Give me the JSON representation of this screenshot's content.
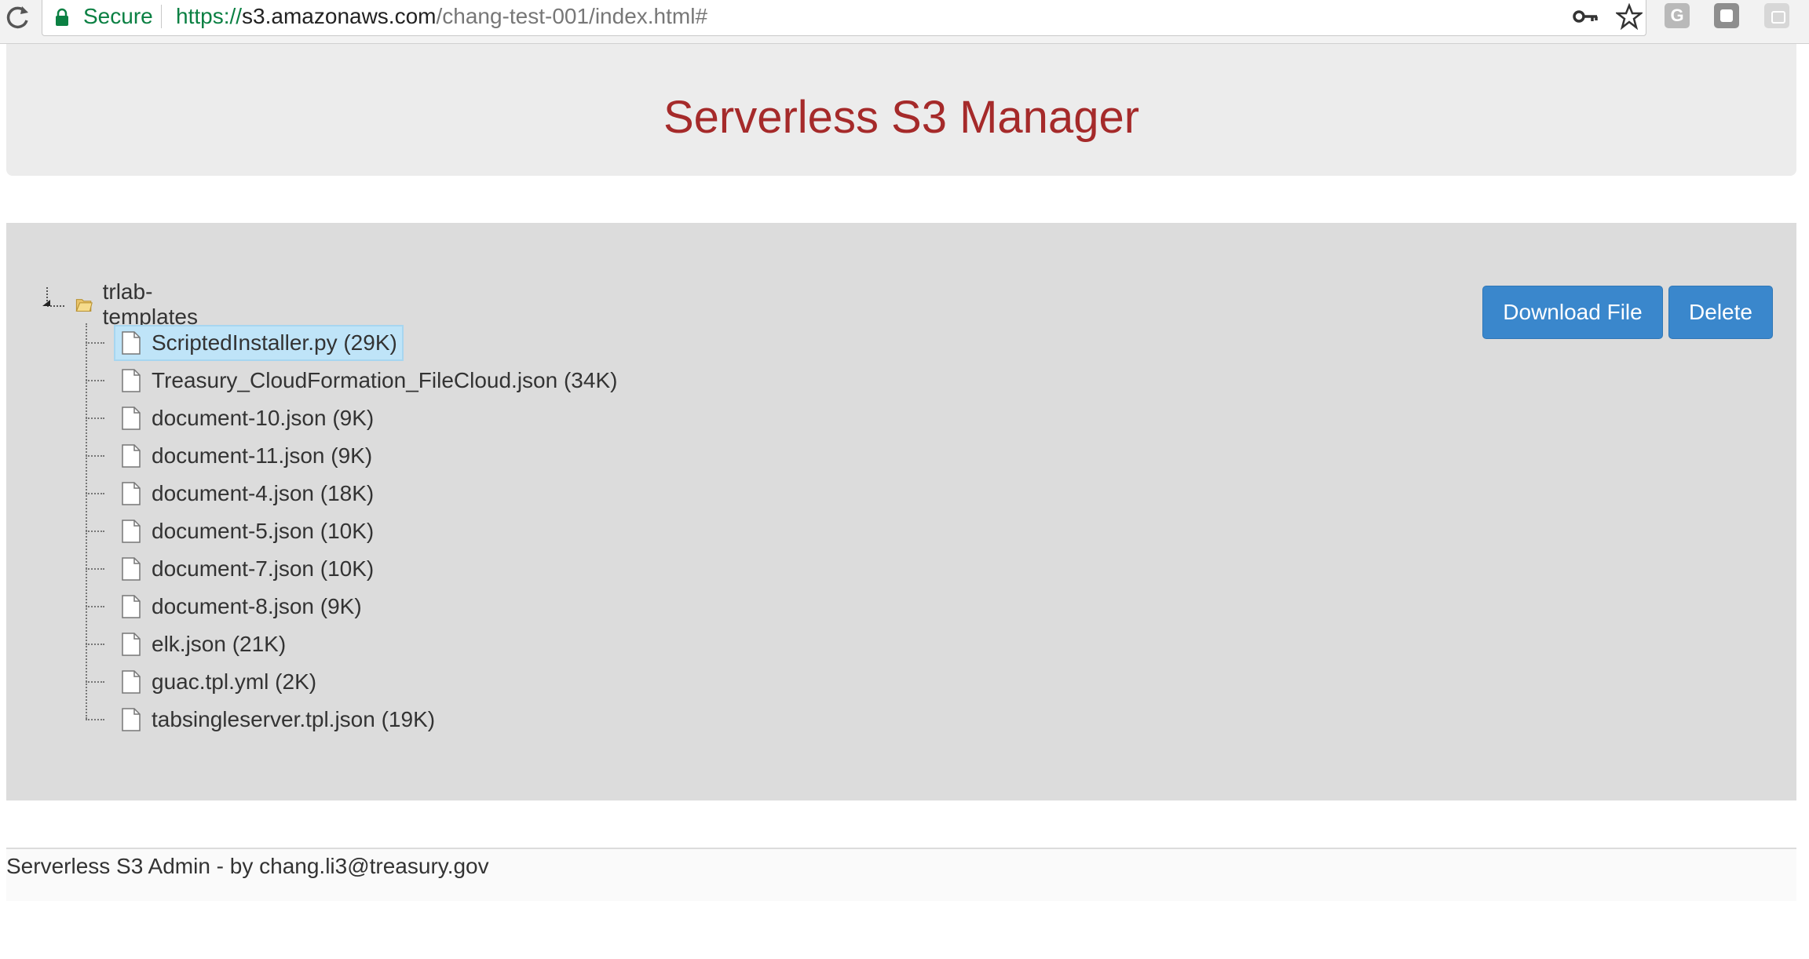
{
  "browser": {
    "secure_label": "Secure",
    "url_scheme": "https://",
    "url_host": "s3.amazonaws.com",
    "url_path": "/chang-test-001/index.html#",
    "extension_1_letter": "G"
  },
  "header": {
    "title": "Serverless S3 Manager"
  },
  "tree": {
    "root_label": "trlab-templates",
    "files": [
      {
        "label": "ScriptedInstaller.py (29K)",
        "selected": true
      },
      {
        "label": "Treasury_CloudFormation_FileCloud.json (34K)",
        "selected": false
      },
      {
        "label": "document-10.json (9K)",
        "selected": false
      },
      {
        "label": "document-11.json (9K)",
        "selected": false
      },
      {
        "label": "document-4.json (18K)",
        "selected": false
      },
      {
        "label": "document-5.json (10K)",
        "selected": false
      },
      {
        "label": "document-7.json (10K)",
        "selected": false
      },
      {
        "label": "document-8.json (9K)",
        "selected": false
      },
      {
        "label": "elk.json (21K)",
        "selected": false
      },
      {
        "label": "guac.tpl.yml (2K)",
        "selected": false
      },
      {
        "label": "tabsingleserver.tpl.json (19K)",
        "selected": false
      }
    ]
  },
  "actions": {
    "download_label": "Download File",
    "delete_label": "Delete"
  },
  "footer": {
    "text": "Serverless S3 Admin - by chang.li3@treasury.gov"
  },
  "colors": {
    "title": "#a52a2a",
    "button": "#3a87cc",
    "selection": "#bfe4f8",
    "secure": "#0b8043"
  }
}
